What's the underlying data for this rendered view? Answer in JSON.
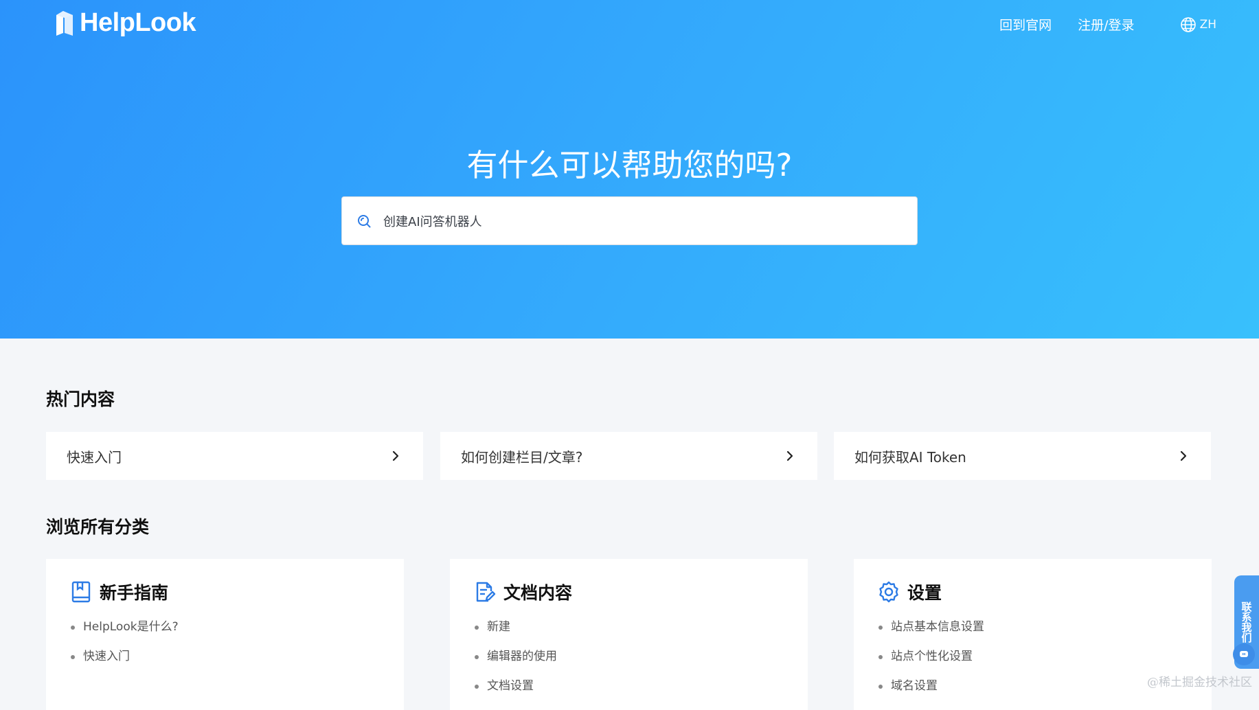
{
  "brand": {
    "name": "HelpLook"
  },
  "nav": {
    "back_home": "回到官网",
    "register_login": "注册/登录",
    "language": "ZH"
  },
  "hero": {
    "title": "有什么可以帮助您的吗?",
    "search_value": "创建AI问答机器人"
  },
  "hot": {
    "title": "热门内容",
    "items": [
      {
        "label": "快速入门"
      },
      {
        "label": "如何创建栏目/文章?"
      },
      {
        "label": "如何获取AI Token"
      }
    ]
  },
  "categories": {
    "title": "浏览所有分类",
    "items": [
      {
        "title": "新手指南",
        "icon": "book-icon",
        "links": [
          "HelpLook是什么?",
          "快速入门"
        ]
      },
      {
        "title": "文档内容",
        "icon": "document-edit-icon",
        "links": [
          "新建",
          "编辑器的使用",
          "文档设置"
        ]
      },
      {
        "title": "设置",
        "icon": "settings-gear-icon",
        "links": [
          "站点基本信息设置",
          "站点个性化设置",
          "域名设置"
        ]
      }
    ]
  },
  "float": {
    "contact": "联系我们"
  },
  "watermark": "@稀土掘金技术社区",
  "colors": {
    "hero_start": "#2b93fb",
    "hero_end": "#38c0fc",
    "accent": "#2c7be5",
    "page_bg": "#f4f6f9"
  }
}
